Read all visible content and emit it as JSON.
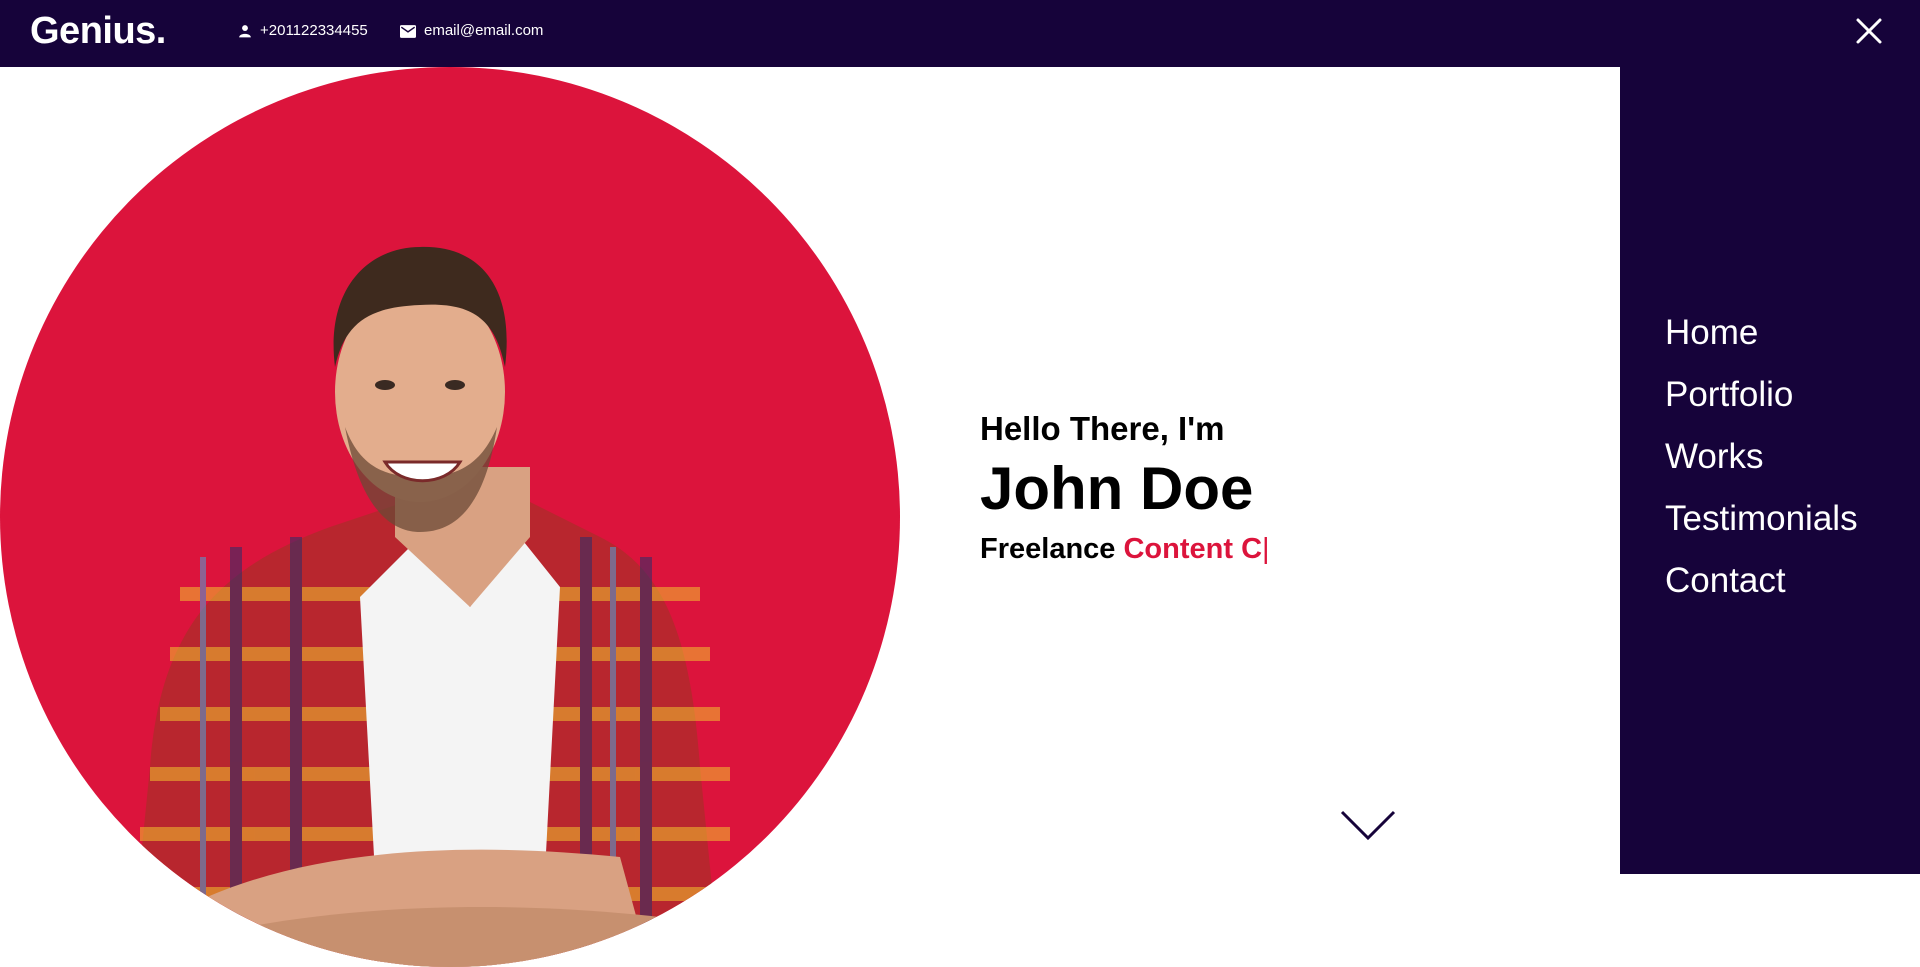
{
  "header": {
    "logo": "Genius.",
    "phone": "+201122334455",
    "email": "email@email.com",
    "phone_icon": "person-icon",
    "email_icon": "mail-icon",
    "close_icon": "close-icon"
  },
  "menu": {
    "items": [
      "Home",
      "Portfolio",
      "Works",
      "Testimonials",
      "Contact"
    ]
  },
  "hero": {
    "greeting": "Hello There, I'm",
    "name": "John Doe",
    "role_prefix": "Freelance",
    "role_typed": "Content C",
    "cursor": "|",
    "scroll_icon": "chevron-down-icon"
  },
  "colors": {
    "navy": "#16033a",
    "accent": "#dc143c",
    "text": "#000000",
    "background": "#ffffff"
  }
}
